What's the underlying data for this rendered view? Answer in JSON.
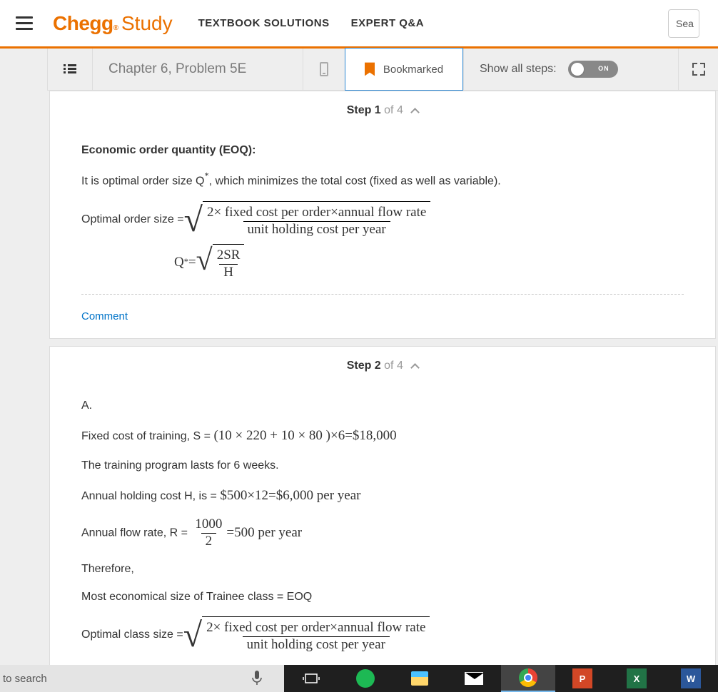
{
  "header": {
    "logo_bold": "Chegg",
    "logo_light": "Study",
    "nav1": "TEXTBOOK SOLUTIONS",
    "nav2": "EXPERT Q&A",
    "search_placeholder": "Sea"
  },
  "subhead": {
    "chapter_label": "Chapter 6, Problem 5E",
    "bookmark_label": "Bookmarked",
    "steps_label": "Show all steps:",
    "toggle_state": "ON"
  },
  "step1": {
    "step_word": "Step 1",
    "of_word": " of 4",
    "heading": "Economic order quantity (EOQ):",
    "intro1": "It is optimal order size Q",
    "intro2": ", which minimizes the total cost (fixed as well as variable).",
    "eq1_prefix": "Optimal order size = ",
    "eq1_num": "2× fixed cost per order×annual flow rate",
    "eq1_den": "unit holding cost per year",
    "eq2_lhs": "Q",
    "eq2_num": "2SR",
    "eq2_den": "H",
    "comment": "Comment"
  },
  "step2": {
    "step_word": "Step 2",
    "of_word": " of 4",
    "A": "A.",
    "line_fc_pre": "Fixed cost of training, S  =",
    "line_fc_math": "(10 × 220 + 10 × 80 )×6=$18,000",
    "line_weeks": "The training program lasts for 6 weeks.",
    "line_h_pre": "Annual holding cost H, is  =",
    "line_h_math": "$500×12=$6,000 per year",
    "line_r_pre": "Annual flow rate, R  =",
    "line_r_num": "1000",
    "line_r_den": "2",
    "line_r_tail": "=500 per year",
    "therefore": "Therefore,",
    "eoq_line": "Most economical size of Trainee class = EOQ",
    "eq_prefix": "Optimal class size = ",
    "eq_num": "2× fixed cost per order×annual flow rate",
    "eq_den": "unit holding cost per year"
  },
  "taskbar": {
    "search_text": " to search"
  }
}
